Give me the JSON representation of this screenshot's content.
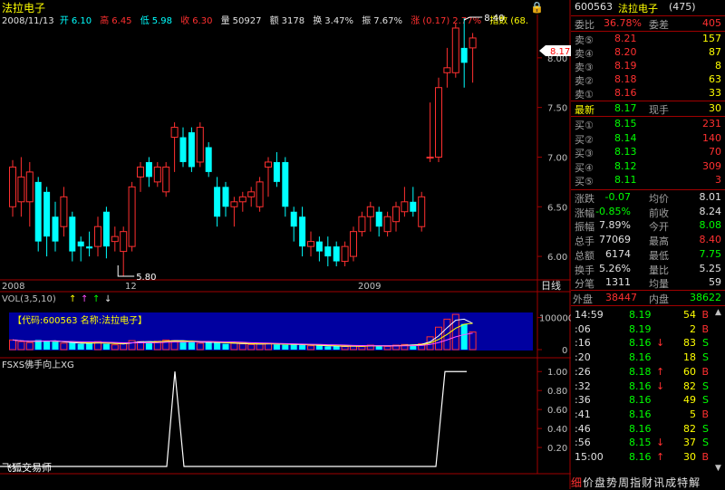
{
  "header": {
    "title": "法拉电子",
    "date": "2008/11/13",
    "open_label": "开",
    "open": "6.10",
    "high_label": "高",
    "high": "6.45",
    "low_label": "低",
    "low": "5.98",
    "close_label": "收",
    "close": "6.30",
    "volume_label": "量",
    "volume": "50927",
    "amount_label": "额",
    "amount": "3178",
    "turnover_label": "换",
    "turnover": "3.47%",
    "amplitude_label": "振",
    "amplitude": "7.67%",
    "change_label": "涨",
    "change": "(0.17)",
    "change_pct": "2.77%",
    "index_label": "指数",
    "index_value": "(68."
  },
  "price_chart": {
    "price_ticks": [
      "8.00",
      "7.50",
      "7.00",
      "6.50",
      "6.00"
    ],
    "x_labels": [
      "2008",
      "12",
      "2009"
    ],
    "high_marker": "8.40",
    "low_marker": "5.80",
    "current_price_tag": "8.17",
    "period_label": "日线"
  },
  "chart_data": {
    "type": "candlestick",
    "ylim": [
      5.8,
      8.4
    ],
    "candles": [
      {
        "o": 6.5,
        "c": 6.9,
        "h": 6.97,
        "l": 6.4,
        "up": true
      },
      {
        "o": 6.8,
        "c": 6.55,
        "h": 7.0,
        "l": 6.4,
        "up": true
      },
      {
        "o": 6.85,
        "c": 6.55,
        "h": 6.95,
        "l": 6.3,
        "up": true
      },
      {
        "o": 6.75,
        "c": 6.15,
        "h": 6.8,
        "l": 6.05,
        "up": false
      },
      {
        "o": 6.65,
        "c": 6.2,
        "h": 6.7,
        "l": 6.0,
        "up": false
      },
      {
        "o": 6.4,
        "c": 6.15,
        "h": 6.55,
        "l": 6.05,
        "up": false
      },
      {
        "o": 6.3,
        "c": 6.6,
        "h": 6.7,
        "l": 6.2,
        "up": true
      },
      {
        "o": 6.4,
        "c": 6.05,
        "h": 6.45,
        "l": 5.95,
        "up": false
      },
      {
        "o": 6.15,
        "c": 6.1,
        "h": 6.2,
        "l": 5.95,
        "up": false
      },
      {
        "o": 6.1,
        "c": 6.08,
        "h": 6.25,
        "l": 6.0,
        "up": false
      },
      {
        "o": 6.1,
        "c": 6.3,
        "h": 6.4,
        "l": 6.0,
        "up": true
      },
      {
        "o": 6.45,
        "c": 6.1,
        "h": 6.5,
        "l": 5.98,
        "up": false
      },
      {
        "o": 6.2,
        "c": 6.15,
        "h": 6.3,
        "l": 6.05,
        "up": true
      },
      {
        "o": 6.05,
        "c": 6.25,
        "h": 6.3,
        "l": 5.8,
        "up": true
      },
      {
        "o": 6.1,
        "c": 6.7,
        "h": 6.75,
        "l": 6.05,
        "up": true
      },
      {
        "o": 6.8,
        "c": 6.9,
        "h": 6.95,
        "l": 6.65,
        "up": true
      },
      {
        "o": 6.95,
        "c": 6.8,
        "h": 7.0,
        "l": 6.7,
        "up": false
      },
      {
        "o": 6.75,
        "c": 6.9,
        "h": 6.95,
        "l": 6.7,
        "up": true
      },
      {
        "o": 6.65,
        "c": 6.9,
        "h": 6.95,
        "l": 6.6,
        "up": true
      },
      {
        "o": 7.2,
        "c": 7.3,
        "h": 7.35,
        "l": 6.85,
        "up": true
      },
      {
        "o": 7.2,
        "c": 6.95,
        "h": 7.3,
        "l": 6.9,
        "up": false
      },
      {
        "o": 7.25,
        "c": 6.9,
        "h": 7.3,
        "l": 6.85,
        "up": false
      },
      {
        "o": 6.95,
        "c": 7.3,
        "h": 7.35,
        "l": 6.9,
        "up": true
      },
      {
        "o": 7.1,
        "c": 6.85,
        "h": 7.15,
        "l": 6.8,
        "up": false
      },
      {
        "o": 6.7,
        "c": 6.4,
        "h": 6.8,
        "l": 6.3,
        "up": false
      },
      {
        "o": 6.7,
        "c": 6.5,
        "h": 6.75,
        "l": 6.4,
        "up": false
      },
      {
        "o": 6.5,
        "c": 6.55,
        "h": 6.6,
        "l": 6.3,
        "up": true
      },
      {
        "o": 6.55,
        "c": 6.6,
        "h": 6.65,
        "l": 6.45,
        "up": true
      },
      {
        "o": 6.6,
        "c": 6.65,
        "h": 6.7,
        "l": 6.5,
        "up": true
      },
      {
        "o": 6.5,
        "c": 6.75,
        "h": 6.8,
        "l": 6.45,
        "up": true
      },
      {
        "o": 6.95,
        "c": 6.9,
        "h": 7.0,
        "l": 6.6,
        "up": true
      },
      {
        "o": 6.95,
        "c": 6.75,
        "h": 7.05,
        "l": 6.7,
        "up": false
      },
      {
        "o": 6.95,
        "c": 6.5,
        "h": 7.0,
        "l": 6.4,
        "up": false
      },
      {
        "o": 6.45,
        "c": 6.3,
        "h": 6.5,
        "l": 6.15,
        "up": false
      },
      {
        "o": 6.4,
        "c": 6.1,
        "h": 6.5,
        "l": 6.0,
        "up": false
      },
      {
        "o": 6.15,
        "c": 6.1,
        "h": 6.25,
        "l": 6.0,
        "up": true
      },
      {
        "o": 6.15,
        "c": 6.05,
        "h": 6.2,
        "l": 5.95,
        "up": false
      },
      {
        "o": 6.1,
        "c": 6.0,
        "h": 6.2,
        "l": 5.9,
        "up": false
      },
      {
        "o": 6.1,
        "c": 5.95,
        "h": 6.15,
        "l": 5.9,
        "up": false
      },
      {
        "o": 5.95,
        "c": 6.1,
        "h": 6.15,
        "l": 5.9,
        "up": true
      },
      {
        "o": 6.0,
        "c": 6.25,
        "h": 6.3,
        "l": 5.95,
        "up": true
      },
      {
        "o": 6.25,
        "c": 6.4,
        "h": 6.45,
        "l": 6.2,
        "up": true
      },
      {
        "o": 6.4,
        "c": 6.5,
        "h": 6.55,
        "l": 6.25,
        "up": true
      },
      {
        "o": 6.45,
        "c": 6.3,
        "h": 6.5,
        "l": 6.2,
        "up": false
      },
      {
        "o": 6.25,
        "c": 6.4,
        "h": 6.45,
        "l": 6.2,
        "up": true
      },
      {
        "o": 6.35,
        "c": 6.5,
        "h": 6.55,
        "l": 6.25,
        "up": true
      },
      {
        "o": 6.55,
        "c": 6.45,
        "h": 6.7,
        "l": 6.4,
        "up": true
      },
      {
        "o": 6.55,
        "c": 6.45,
        "h": 6.7,
        "l": 6.4,
        "up": false
      },
      {
        "o": 6.3,
        "c": 6.6,
        "h": 6.65,
        "l": 6.25,
        "up": true
      },
      {
        "o": 7.0,
        "c": 7.0,
        "h": 7.55,
        "l": 6.95,
        "up": true
      },
      {
        "o": 7.0,
        "c": 7.7,
        "h": 7.8,
        "l": 6.95,
        "up": true
      },
      {
        "o": 7.85,
        "c": 7.9,
        "h": 8.1,
        "l": 7.7,
        "up": true
      },
      {
        "o": 7.85,
        "c": 8.3,
        "h": 8.35,
        "l": 7.8,
        "up": true
      },
      {
        "o": 8.1,
        "c": 7.95,
        "h": 8.4,
        "l": 7.7,
        "up": false
      },
      {
        "o": 8.1,
        "c": 8.2,
        "h": 8.25,
        "l": 7.75,
        "up": true
      }
    ],
    "volume": {
      "label": "VOL(3,5,10)",
      "ticks": [
        "100000",
        "0"
      ],
      "values": [
        30,
        25,
        22,
        30,
        28,
        25,
        20,
        22,
        18,
        20,
        25,
        18,
        15,
        20,
        28,
        25,
        22,
        26,
        30,
        28,
        26,
        24,
        20,
        25,
        22,
        18,
        20,
        18,
        16,
        18,
        20,
        16,
        15,
        18,
        14,
        12,
        14,
        10,
        11,
        10,
        12,
        10,
        14,
        12,
        10,
        14,
        16,
        15,
        18,
        40,
        70,
        95,
        110,
        80,
        55
      ],
      "ylim": [
        0,
        130
      ]
    },
    "indicator": {
      "label": "FSXS佛手向上XG",
      "ticks": [
        "1.00",
        "0.80",
        "0.60",
        "0.40",
        "0.20"
      ],
      "ylim": [
        0,
        1.05
      ]
    }
  },
  "volume_banner": {
    "code_label": "【代码:600563 名称:法拉电子】"
  },
  "branding": {
    "watermark": "飞狐交易师"
  },
  "quote": {
    "code": "600563",
    "name": "法拉电子",
    "count": "(475)",
    "wb_label": "委比",
    "wb_value": "36.78%",
    "wc_label": "委差",
    "wc_value": "405",
    "sells": [
      {
        "label": "卖⑤",
        "price": "8.21",
        "vol": "157"
      },
      {
        "label": "卖④",
        "price": "8.20",
        "vol": "87"
      },
      {
        "label": "卖③",
        "price": "8.19",
        "vol": "8"
      },
      {
        "label": "卖②",
        "price": "8.18",
        "vol": "63"
      },
      {
        "label": "卖①",
        "price": "8.16",
        "vol": "33"
      }
    ],
    "latest_label": "最新",
    "latest_price": "8.17",
    "xianshou_label": "现手",
    "xianshou": "30",
    "buys": [
      {
        "label": "买①",
        "price": "8.15",
        "vol": "231"
      },
      {
        "label": "买②",
        "price": "8.14",
        "vol": "140"
      },
      {
        "label": "买③",
        "price": "8.13",
        "vol": "70"
      },
      {
        "label": "买④",
        "price": "8.12",
        "vol": "309"
      },
      {
        "label": "买⑤",
        "price": "8.11",
        "vol": "3"
      }
    ],
    "stats": [
      {
        "l1": "涨跌",
        "v1": "-0.07",
        "l2": "均价",
        "v2": "8.01",
        "c1": "#00ff00",
        "c2": "#e0e0e0"
      },
      {
        "l1": "涨幅",
        "v1": "-0.85%",
        "l2": "前收",
        "v2": "8.24",
        "c1": "#00ff00",
        "c2": "#e0e0e0"
      },
      {
        "l1": "振幅",
        "v1": "7.89%",
        "l2": "今开",
        "v2": "8.08",
        "c1": "#e0e0e0",
        "c2": "#00ff00"
      },
      {
        "l1": "总手",
        "v1": "77069",
        "l2": "最高",
        "v2": "8.40",
        "c1": "#e0e0e0",
        "c2": "#ff3030"
      },
      {
        "l1": "总额",
        "v1": "6174",
        "l2": "最低",
        "v2": "7.75",
        "c1": "#e0e0e0",
        "c2": "#00ff00"
      },
      {
        "l1": "换手",
        "v1": "5.26%",
        "l2": "量比",
        "v2": "5.25",
        "c1": "#e0e0e0",
        "c2": "#e0e0e0"
      },
      {
        "l1": "分笔",
        "v1": "1311",
        "l2": "均量",
        "v2": "59",
        "c1": "#e0e0e0",
        "c2": "#e0e0e0"
      }
    ],
    "outer_label": "外盘",
    "outer_value": "38447",
    "inner_label": "内盘",
    "inner_value": "38622",
    "ticks": [
      {
        "t": "14:59",
        "p": "8.19",
        "arr": "",
        "v": "54",
        "s": "B",
        "pc": "#00ff00",
        "sc": "#ff3030"
      },
      {
        "t": ":06",
        "p": "8.19",
        "arr": "",
        "v": "2",
        "s": "B",
        "pc": "#00ff00",
        "sc": "#ff3030"
      },
      {
        "t": ":16",
        "p": "8.16",
        "arr": "↓",
        "v": "83",
        "s": "S",
        "pc": "#00ff00",
        "sc": "#00ff00"
      },
      {
        "t": ":20",
        "p": "8.16",
        "arr": "",
        "v": "18",
        "s": "S",
        "pc": "#00ff00",
        "sc": "#00ff00"
      },
      {
        "t": ":26",
        "p": "8.18",
        "arr": "↑",
        "v": "60",
        "s": "B",
        "pc": "#00ff00",
        "sc": "#ff3030"
      },
      {
        "t": ":32",
        "p": "8.16",
        "arr": "↓",
        "v": "82",
        "s": "S",
        "pc": "#00ff00",
        "sc": "#00ff00"
      },
      {
        "t": ":36",
        "p": "8.16",
        "arr": "",
        "v": "49",
        "s": "S",
        "pc": "#00ff00",
        "sc": "#00ff00"
      },
      {
        "t": ":41",
        "p": "8.16",
        "arr": "",
        "v": "5",
        "s": "B",
        "pc": "#00ff00",
        "sc": "#ff3030"
      },
      {
        "t": ":46",
        "p": "8.16",
        "arr": "",
        "v": "82",
        "s": "S",
        "pc": "#00ff00",
        "sc": "#00ff00"
      },
      {
        "t": ":56",
        "p": "8.15",
        "arr": "↓",
        "v": "37",
        "s": "S",
        "pc": "#00ff00",
        "sc": "#00ff00"
      },
      {
        "t": "15:00",
        "p": "8.16",
        "arr": "↑",
        "v": "30",
        "s": "B",
        "pc": "#00ff00",
        "sc": "#ff3030"
      }
    ]
  },
  "tabs": [
    "细",
    "价",
    "盘",
    "势",
    "周",
    "指",
    "财",
    "讯",
    "成",
    "特",
    "解"
  ]
}
